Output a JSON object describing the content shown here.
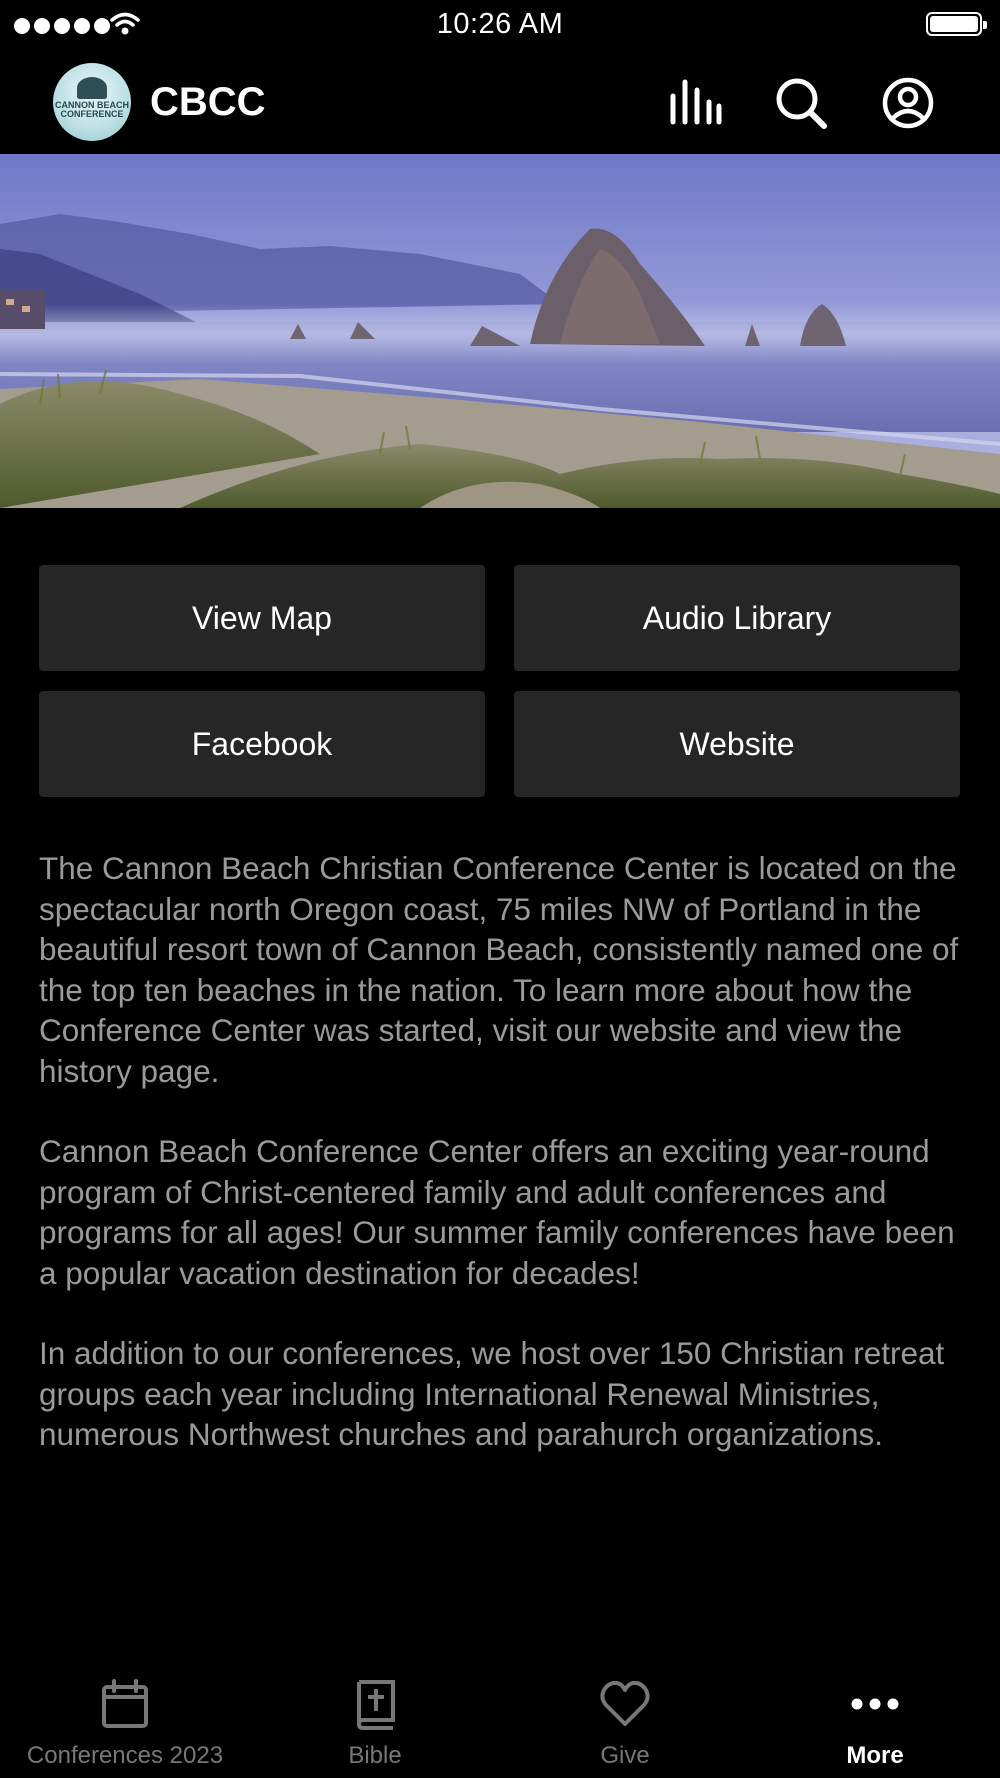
{
  "status_bar": {
    "time": "10:26 AM",
    "battery_level": 1.0,
    "signal_bars": 5,
    "icons": [
      "signal-dots-icon",
      "wifi-icon",
      "battery-icon"
    ]
  },
  "header": {
    "logo_text": "CANNON BEACH CONFERENCE",
    "title": "CBCC",
    "icons": [
      "audio-bars-icon",
      "search-icon",
      "account-icon"
    ]
  },
  "hero": {
    "description": "coastal photograph"
  },
  "buttons": [
    {
      "label": "View Map"
    },
    {
      "label": "Audio Library"
    },
    {
      "label": "Facebook"
    },
    {
      "label": "Website"
    }
  ],
  "body": {
    "paragraphs": [
      "The Cannon Beach Christian Conference Center is located on the spectacular north Oregon coast, 75 miles NW of Portland in the beautiful resort town of Cannon Beach, consistently named one of the top ten beaches in the nation. To learn more about how the Conference Center was started, visit our website  and view the history page.",
      "Cannon Beach Conference Center offers an exciting year-round program of Christ-centered family and adult conferences and programs for all ages! Our summer family conferences have been a popular vacation destination for decades!",
      "In addition to our conferences, we host over 150 Christian retreat groups each year including International Renewal Ministries, numerous Northwest churches and parahurch organizations."
    ]
  },
  "tab_bar": {
    "tabs": [
      {
        "label": "Conferences 2023",
        "icon": "calendar-icon",
        "active": false
      },
      {
        "label": "Bible",
        "icon": "bible-icon",
        "active": false
      },
      {
        "label": "Give",
        "icon": "heart-icon",
        "active": false
      },
      {
        "label": "More",
        "icon": "more-dots-icon",
        "active": true
      }
    ],
    "colors": {
      "active": "#ffffff",
      "inactive": "#777777"
    }
  }
}
